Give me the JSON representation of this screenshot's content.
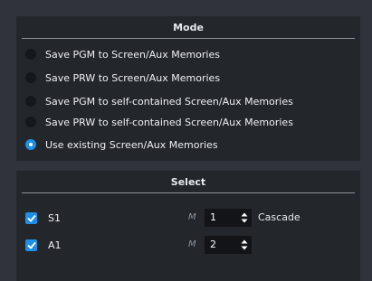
{
  "mode": {
    "title": "Mode",
    "options": [
      {
        "label": "Save PGM to Screen/Aux Memories",
        "checked": false
      },
      {
        "label": "Save PRW to Screen/Aux Memories",
        "checked": false
      },
      {
        "label": "Save PGM to self-contained Screen/Aux Memories",
        "checked": false
      },
      {
        "label": "Save PRW to self-contained Screen/Aux Memories",
        "checked": false
      },
      {
        "label": "Use existing Screen/Aux Memories",
        "checked": true
      }
    ]
  },
  "select": {
    "title": "Select",
    "rows": [
      {
        "label": "S1",
        "checked": true,
        "m_label": "M",
        "value": "1",
        "cascade_label": "Cascade"
      },
      {
        "label": "A1",
        "checked": true,
        "m_label": "M",
        "value": "2"
      }
    ]
  },
  "colors": {
    "accent": "#1f8fe6",
    "panel": "#23262b",
    "background": "#30333a"
  }
}
